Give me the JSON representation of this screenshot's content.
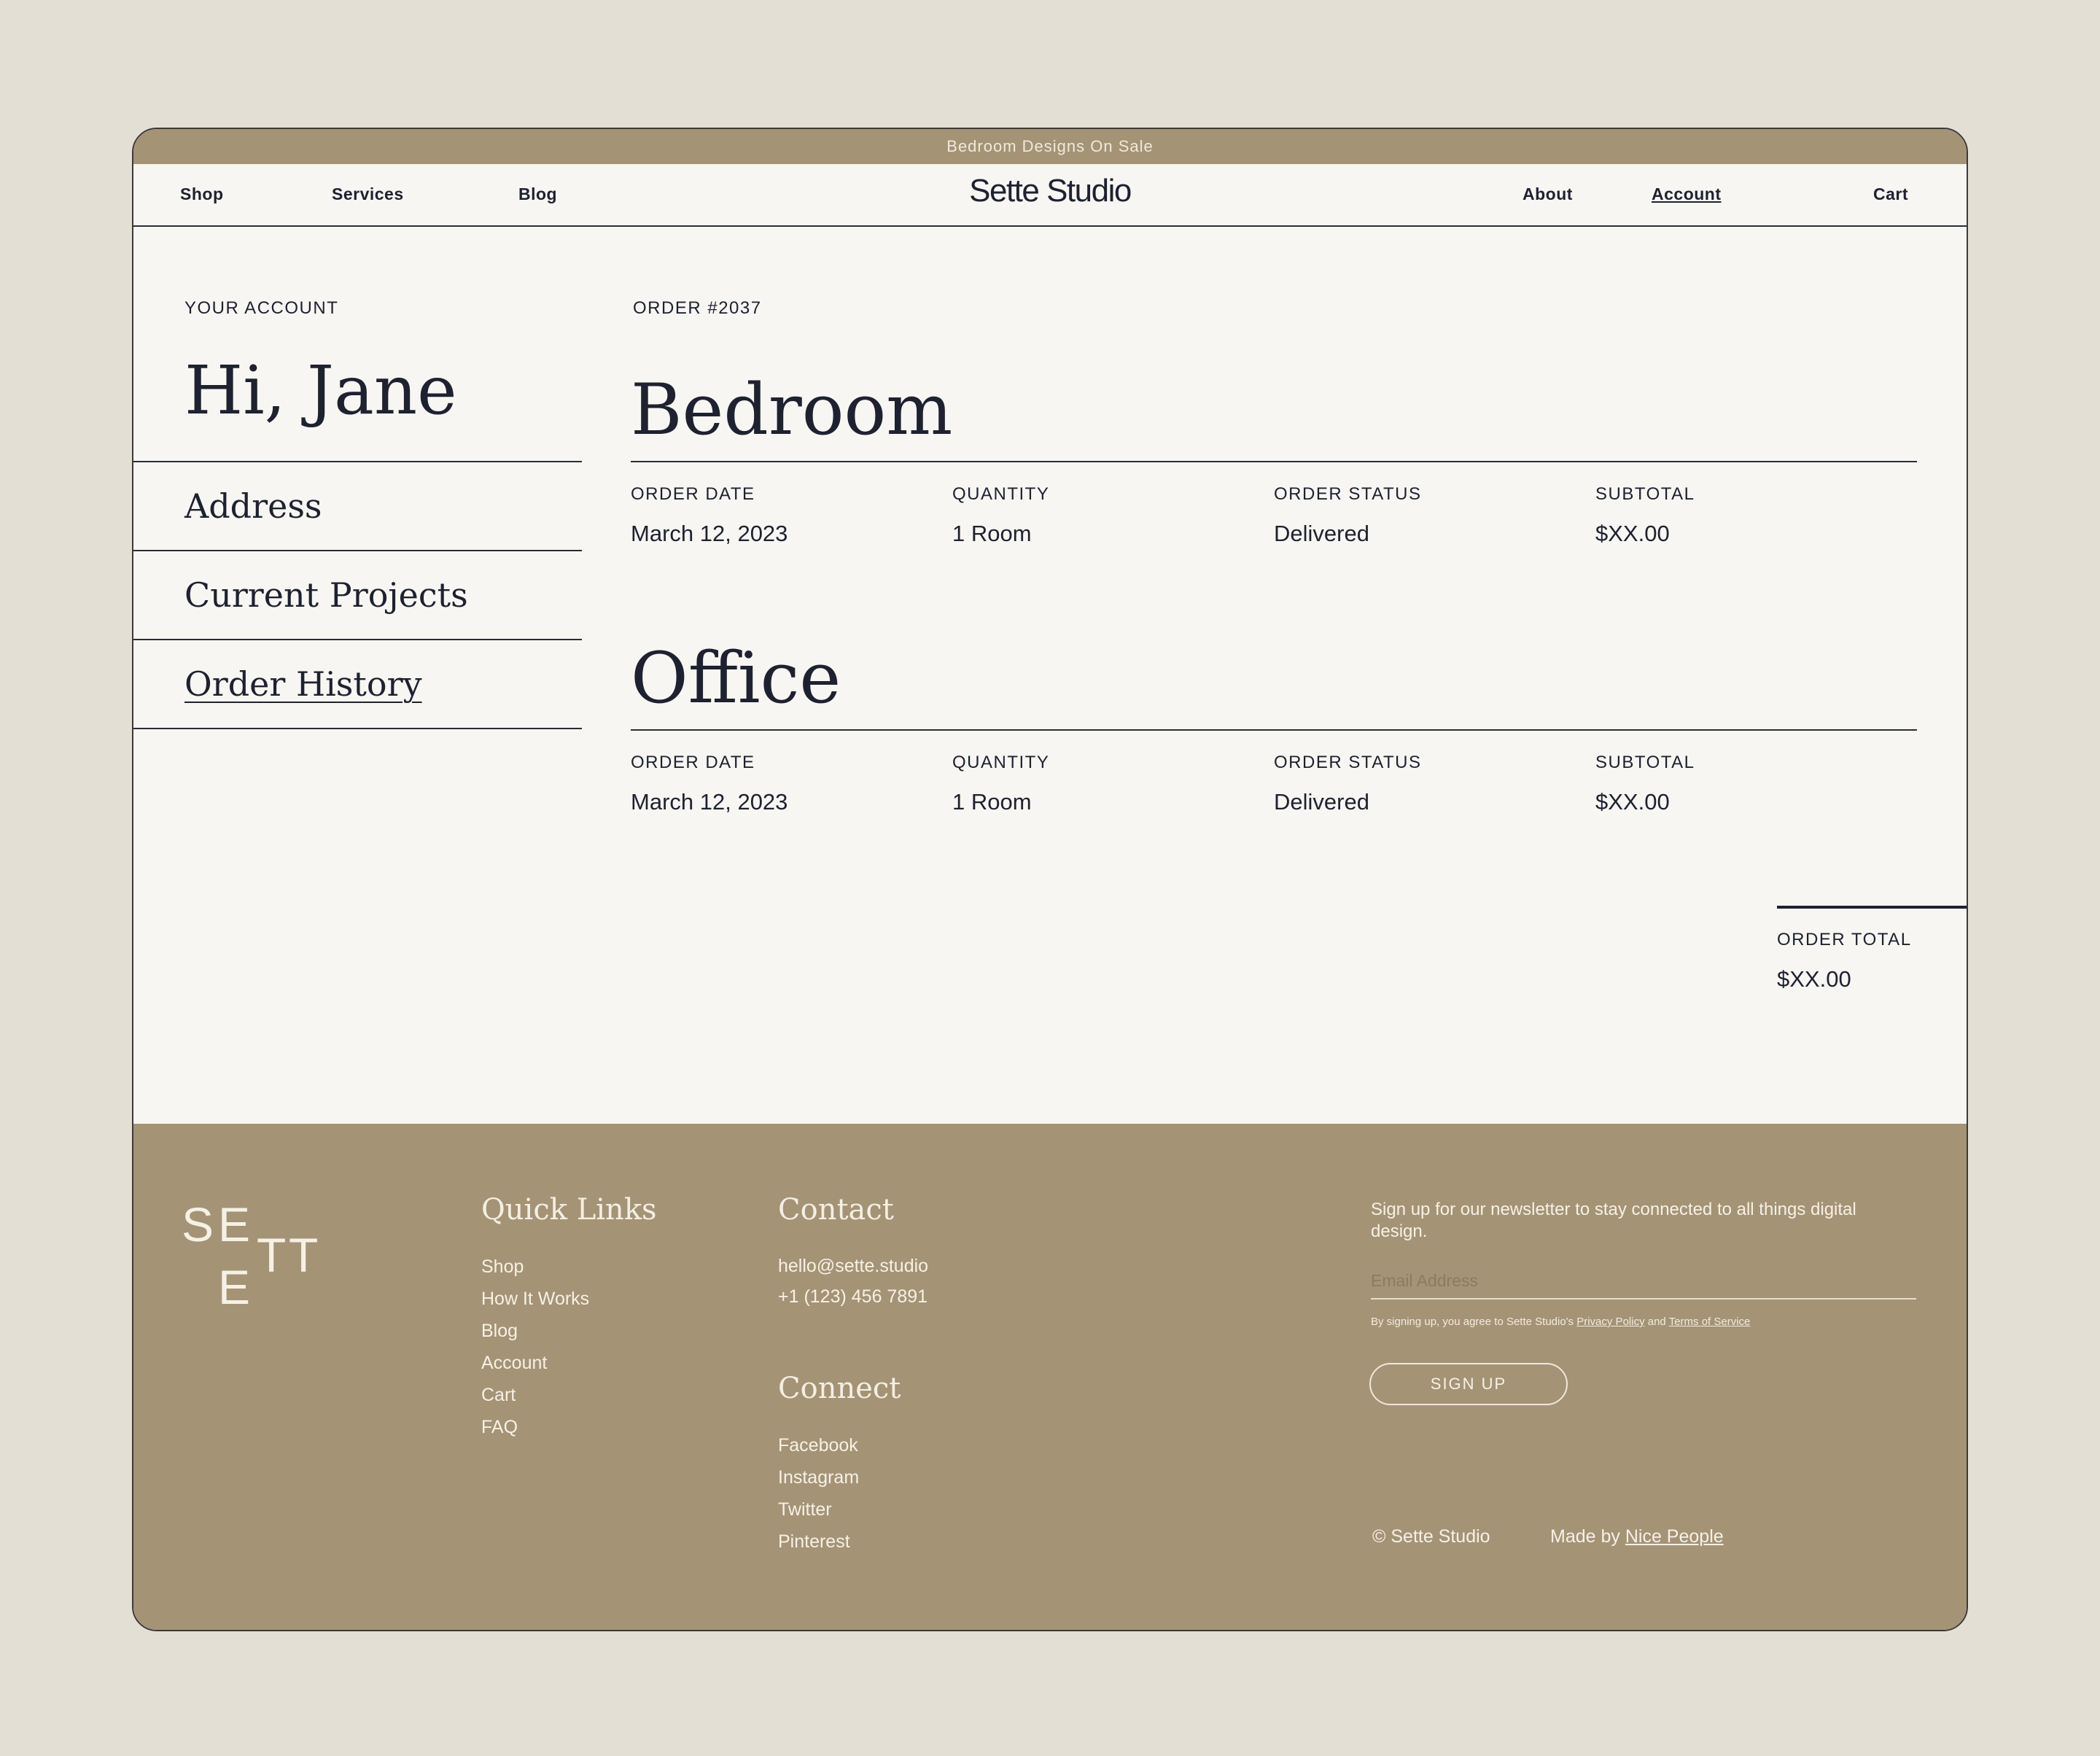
{
  "promo_banner": "Bedroom Designs On Sale",
  "nav": {
    "left": [
      "Shop",
      "Services",
      "Blog"
    ],
    "brand": "Sette Studio",
    "right": [
      "About",
      "Account",
      "Cart"
    ]
  },
  "sidebar": {
    "eyebrow": "YOUR ACCOUNT",
    "greeting": "Hi, Jane",
    "items": [
      {
        "label": "Address"
      },
      {
        "label": "Current Projects"
      },
      {
        "label": "Order History"
      }
    ]
  },
  "main": {
    "order_number": "ORDER #2037",
    "column_headers": [
      "ORDER DATE",
      "QUANTITY",
      "ORDER STATUS",
      "SUBTOTAL"
    ],
    "orders": [
      {
        "name": "Bedroom",
        "date": "March 12, 2023",
        "quantity": "1 Room",
        "status": "Delivered",
        "subtotal": "$XX.00"
      },
      {
        "name": "Office",
        "date": "March 12, 2023",
        "quantity": "1 Room",
        "status": "Delivered",
        "subtotal": "$XX.00"
      }
    ],
    "total_label": "ORDER TOTAL",
    "total_value": "$XX.00"
  },
  "footer": {
    "monogram": [
      "S",
      "E",
      "T",
      "T",
      "E"
    ],
    "quick_links_heading": "Quick Links",
    "quick_links": [
      "Shop",
      "How It Works",
      "Blog",
      "Account",
      "Cart",
      "FAQ"
    ],
    "contact_heading": "Contact",
    "contact": [
      "hello@sette.studio",
      "+1 (123) 456 7891"
    ],
    "connect_heading": "Connect",
    "connect": [
      "Facebook",
      "Instagram",
      "Twitter",
      "Pinterest"
    ],
    "newsletter_text": "Sign up for our newsletter to stay connected to all things digital design.",
    "email_placeholder": "Email Address",
    "legal_prefix": "By signing up, you agree to Sette Studio's",
    "privacy_label": "Privacy Policy",
    "legal_and": "and",
    "terms_label": "Terms of Service",
    "signup_label": "SIGN UP",
    "copyright": "© Sette Studio",
    "made_by_prefix": "Made by",
    "made_by_link": "Nice People"
  }
}
